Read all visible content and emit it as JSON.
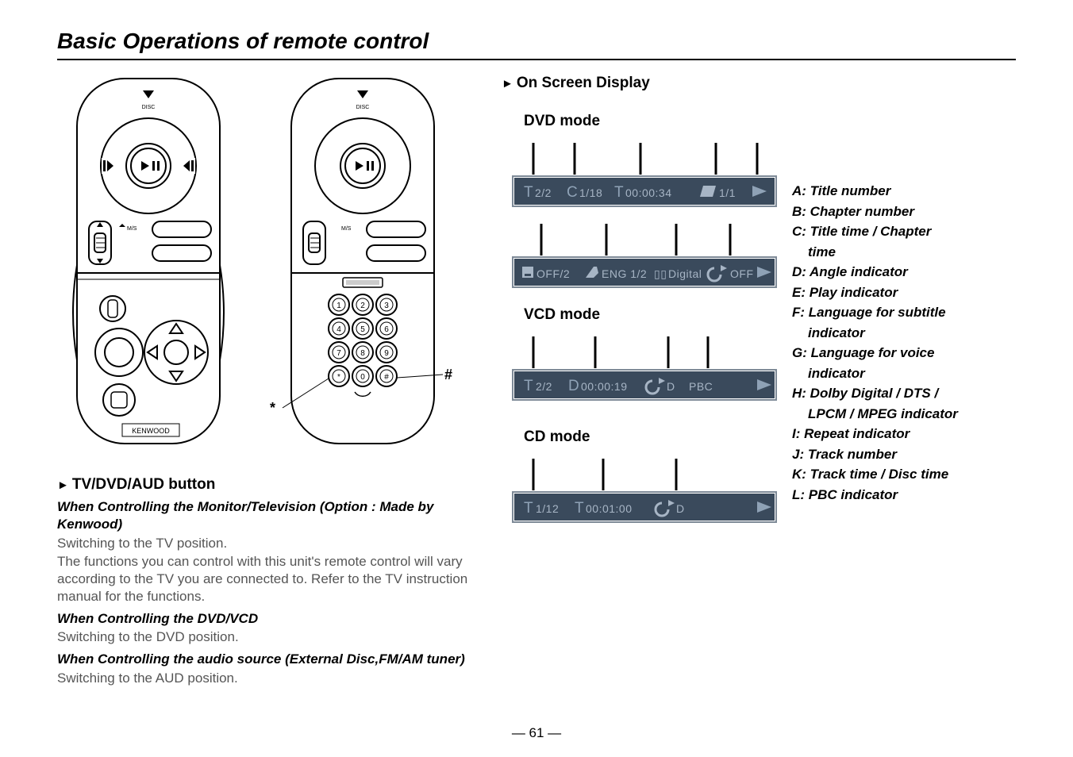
{
  "page_title": "Basic Operations of remote control",
  "page_number": "— 61 —",
  "remote_labels": {
    "star": "*",
    "hash": "#",
    "brand": "KENWOOD",
    "disc": "DISC",
    "mis": "M/S"
  },
  "left": {
    "heading1": "TV/DVD/AUD button",
    "sub1": "When Controlling the Monitor/Television (Option : Made by Kenwood)",
    "body1a": "Switching to the TV position.",
    "body1b": "The functions you can control with this unit's remote control will vary according to the TV you are connected to. Refer to the TV instruction manual for the functions.",
    "sub2": "When Controlling the DVD/VCD",
    "body2a": "Switching to the DVD position.",
    "sub3": "When Controlling the audio source (External Disc,FM/AM tuner)",
    "body3a": "Switching to the AUD position."
  },
  "right": {
    "osd_title": "On Screen Display",
    "dvd_mode": "DVD mode",
    "vcd_mode": "VCD mode",
    "cd_mode": "CD mode",
    "osd": {
      "dvd1": {
        "a": "T",
        "a2": "2/2",
        "b": "C",
        "b2": "1/18",
        "c": "T",
        "c2": "00:00:34",
        "d": "1/1"
      },
      "dvd2": {
        "f": "OFF/2",
        "g": "ENG 1/2",
        "h": "Digital",
        "i": "OFF"
      },
      "vcd": {
        "j": "T",
        "j2": "2/2",
        "k": "D",
        "k2": "00:00:19",
        "i": "D",
        "l": "PBC"
      },
      "cd": {
        "j": "T",
        "j2": "1/12",
        "k": "T",
        "k2": "00:01:00",
        "i": "D"
      }
    },
    "legend": [
      "A: Title number",
      "B: Chapter number",
      "C: Title time / Chapter",
      "   time",
      "D: Angle indicator",
      "E: Play indicator",
      "F: Language for subtitle",
      "   indicator",
      "G: Language for voice",
      "   indicator",
      "H: Dolby Digital / DTS /",
      "   LPCM / MPEG indicator",
      "I:  Repeat indicator",
      "J: Track number",
      "K: Track time / Disc time",
      "L: PBC indicator"
    ]
  }
}
